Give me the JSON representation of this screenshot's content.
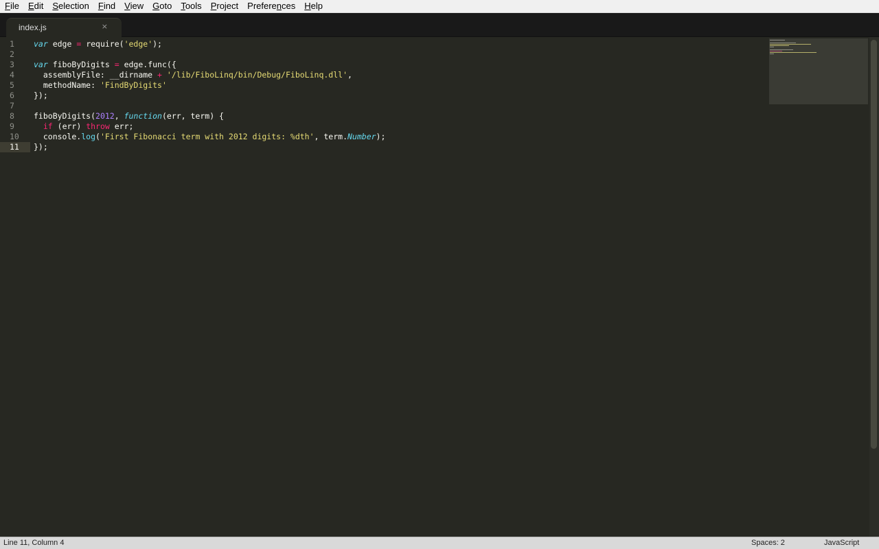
{
  "menu": {
    "items": [
      {
        "key": "F",
        "rest": "ile"
      },
      {
        "key": "E",
        "rest": "dit"
      },
      {
        "key": "S",
        "rest": "election"
      },
      {
        "key": "F",
        "rest": "ind",
        "pre": ""
      },
      {
        "key": "V",
        "rest": "iew"
      },
      {
        "key": "G",
        "rest": "oto"
      },
      {
        "key": "T",
        "rest": "ools"
      },
      {
        "key": "P",
        "rest": "roject"
      },
      {
        "pre": "Prefere",
        "key": "n",
        "rest": "ces"
      },
      {
        "key": "H",
        "rest": "elp"
      }
    ]
  },
  "tab": {
    "label": "index.js",
    "close_glyph": "×"
  },
  "editor": {
    "line_numbers": [
      "1",
      "2",
      "3",
      "4",
      "5",
      "6",
      "7",
      "8",
      "9",
      "10",
      "11"
    ],
    "active_line": 11
  },
  "status": {
    "position": "Line 11, Column 4",
    "spaces": "Spaces: 2",
    "syntax": "JavaScript"
  },
  "theme": {
    "background": "#272822",
    "keyword": "#66d9ef",
    "string": "#e6db74",
    "number": "#ae81ff",
    "operator": "#f92672"
  }
}
